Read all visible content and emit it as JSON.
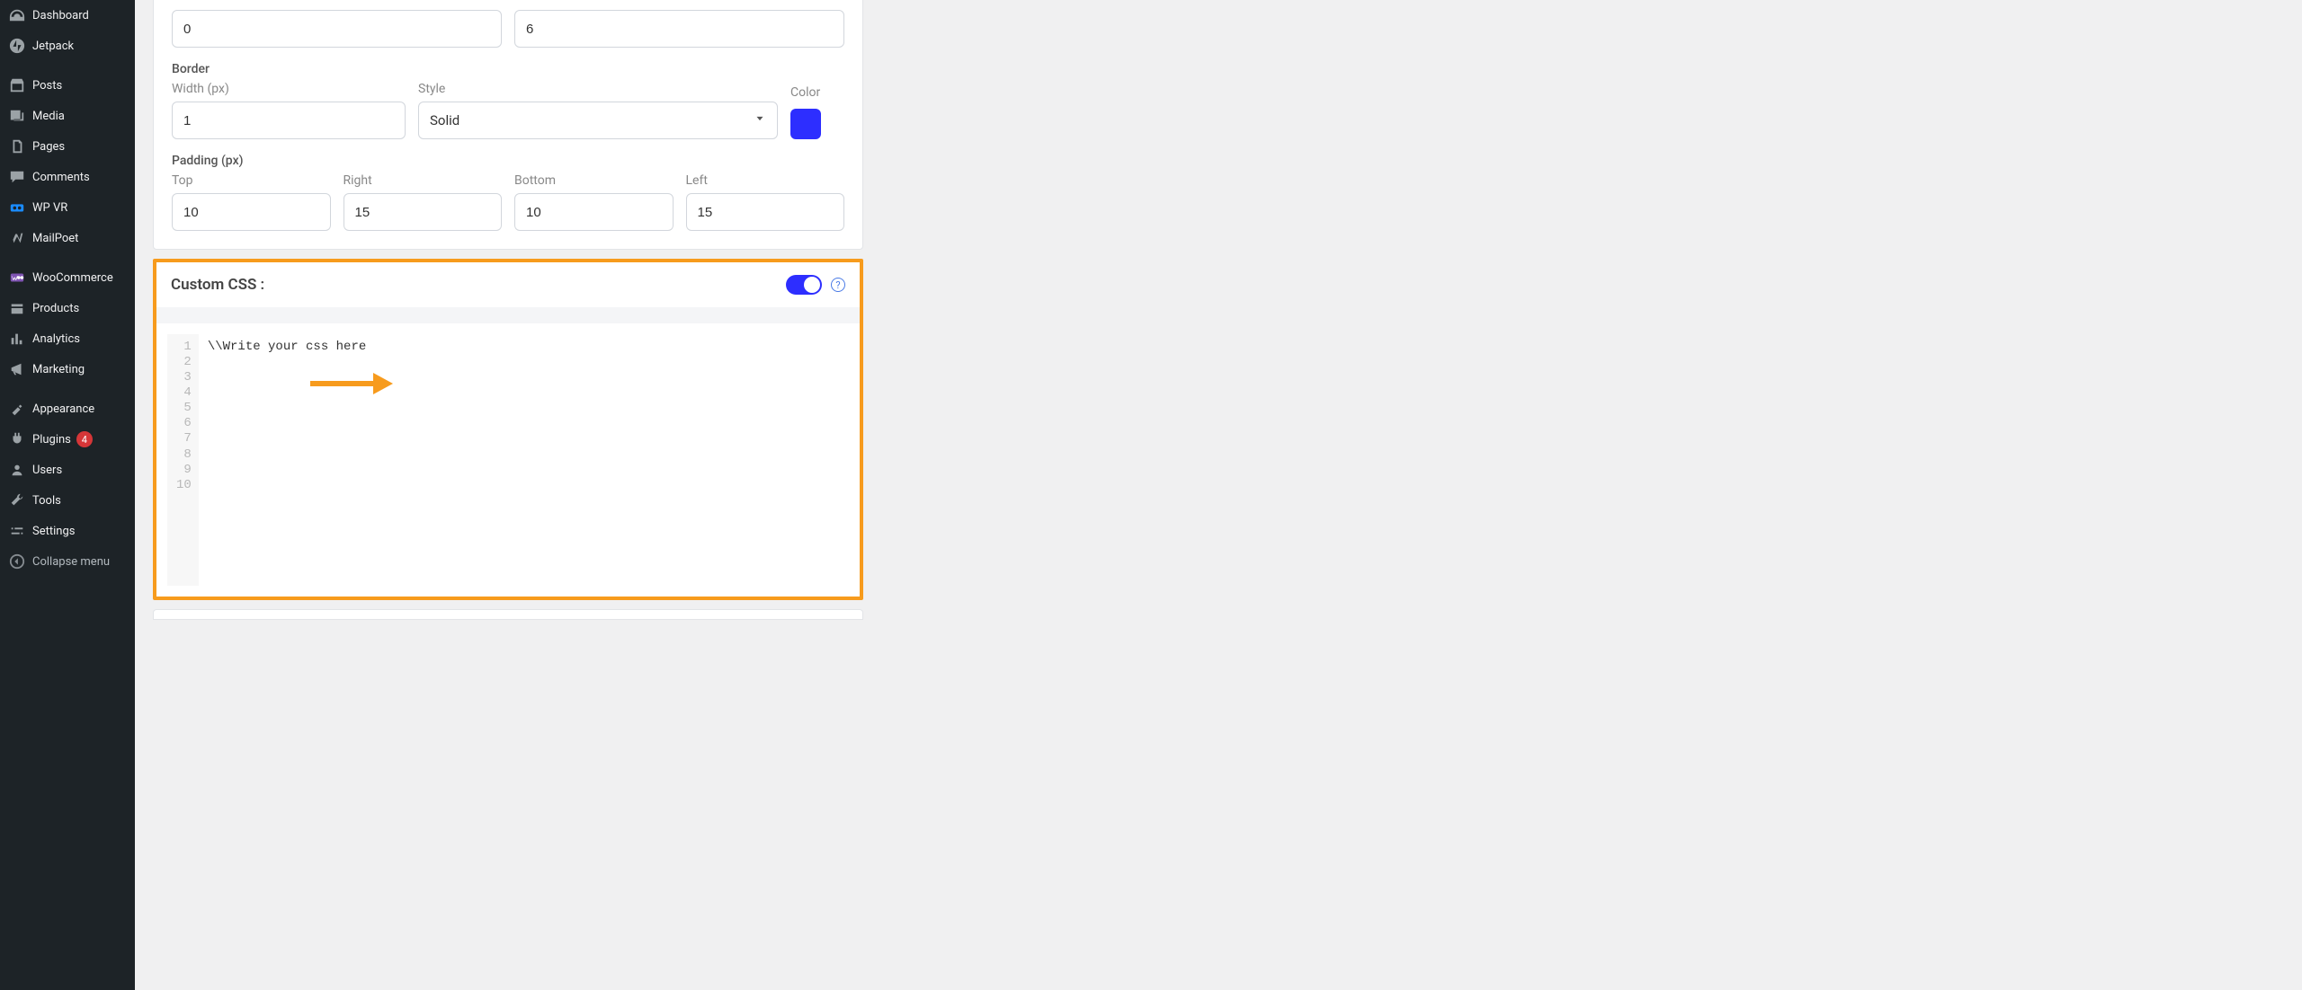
{
  "sidebar": {
    "items": [
      {
        "label": "Dashboard",
        "icon": "dashboard-icon"
      },
      {
        "label": "Jetpack",
        "icon": "jetpack-icon"
      },
      {
        "label": "Posts",
        "icon": "posts-icon"
      },
      {
        "label": "Media",
        "icon": "media-icon"
      },
      {
        "label": "Pages",
        "icon": "pages-icon"
      },
      {
        "label": "Comments",
        "icon": "comments-icon"
      },
      {
        "label": "WP VR",
        "icon": "wpvr-icon"
      },
      {
        "label": "MailPoet",
        "icon": "mailpoet-icon"
      },
      {
        "label": "WooCommerce",
        "icon": "woocommerce-icon"
      },
      {
        "label": "Products",
        "icon": "products-icon"
      },
      {
        "label": "Analytics",
        "icon": "analytics-icon"
      },
      {
        "label": "Marketing",
        "icon": "marketing-icon"
      },
      {
        "label": "Appearance",
        "icon": "appearance-icon"
      },
      {
        "label": "Plugins",
        "icon": "plugins-icon",
        "badge": "4"
      },
      {
        "label": "Users",
        "icon": "users-icon"
      },
      {
        "label": "Tools",
        "icon": "tools-icon"
      },
      {
        "label": "Settings",
        "icon": "settings-icon"
      },
      {
        "label": "Collapse menu",
        "icon": "collapse-icon",
        "collapse": true
      }
    ]
  },
  "form": {
    "top_row": {
      "left_value": "0",
      "right_value": "6"
    },
    "border": {
      "section_label": "Border",
      "width_label": "Width (px)",
      "width_value": "1",
      "style_label": "Style",
      "style_value": "Solid",
      "color_label": "Color",
      "color_value": "#2d2eff"
    },
    "padding": {
      "section_label": "Padding (px)",
      "top_label": "Top",
      "top_value": "10",
      "right_label": "Right",
      "right_value": "15",
      "bottom_label": "Bottom",
      "bottom_value": "10",
      "left_label": "Left",
      "left_value": "15"
    }
  },
  "custom_css": {
    "title": "Custom CSS :",
    "toggle_on": true,
    "help_char": "?",
    "line_numbers": "1\n2\n3\n4\n5\n6\n7\n8\n9\n10",
    "content": "\\\\Write your css here"
  }
}
